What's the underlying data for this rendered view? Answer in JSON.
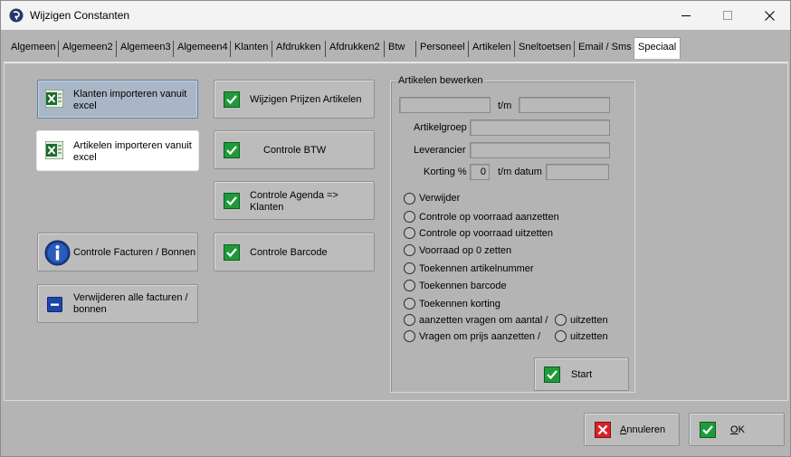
{
  "window": {
    "title": "Wijzigen Constanten"
  },
  "tabs": [
    {
      "label": "Algemeen"
    },
    {
      "label": "Algemeen2"
    },
    {
      "label": "Algemeen3"
    },
    {
      "label": "Algemeen4"
    },
    {
      "label": "Klanten"
    },
    {
      "label": "Afdrukken"
    },
    {
      "label": "Afdrukken2"
    },
    {
      "label": "Btw"
    },
    {
      "label": "Personeel"
    },
    {
      "label": "Artikelen"
    },
    {
      "label": "Sneltoetsen"
    },
    {
      "label": "Email / Sms"
    },
    {
      "label": "Speciaal",
      "active": true
    }
  ],
  "buttons": {
    "klanten_import": "Klanten importeren vanuit excel",
    "artikelen_import": "Artikelen importeren vanuit excel",
    "controle_facturen": "Controle Facturen / Bonnen",
    "verwijderen_facturen": "Verwijderen alle facturen / bonnen",
    "wijzigen_prijzen": "Wijzigen Prijzen Artikelen",
    "controle_btw": "Controle BTW",
    "controle_agenda": "Controle Agenda => Klanten",
    "controle_barcode": "Controle Barcode"
  },
  "artikelen_bewerken": {
    "title": "Artikelen bewerken",
    "tm_label": "t/m",
    "artikelgroep_label": "Artikelgroep",
    "leverancier_label": "Leverancier",
    "korting_label": "Korting %",
    "korting_value": "0",
    "tm_datum_label": "t/m datum",
    "options": [
      "Verwijder",
      "Controle op voorraad aanzetten",
      "Controle op voorraad uitzetten",
      "Voorraad op 0 zetten",
      "Toekennen artikelnummer",
      "Toekennen barcode",
      "Toekennen korting",
      "aanzetten vragen om aantal /",
      "Vragen om prijs aanzetten /"
    ],
    "uitzetten_1": "uitzetten",
    "uitzetten_2": "uitzetten",
    "start_label": "Start"
  },
  "footer": {
    "annuleren": "Annuleren",
    "ok": "OK"
  },
  "colors": {
    "dialog_bg": "#b4b4b4",
    "focused_button": "#a9b6c6",
    "check_green": "#1f9a3a",
    "cancel_red": "#d9222a"
  }
}
